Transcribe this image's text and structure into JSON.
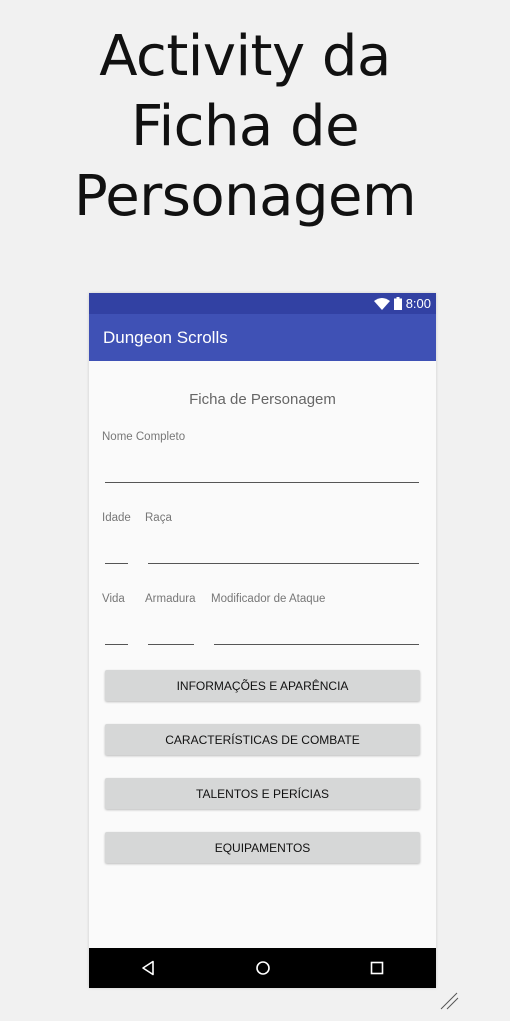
{
  "headline": {
    "line1": "Activity da",
    "line2": "Ficha de",
    "line3": "Personagem"
  },
  "status": {
    "time": "8:00"
  },
  "app": {
    "title": "Dungeon Scrolls"
  },
  "form": {
    "title": "Ficha de Personagem",
    "labels": {
      "nome": "Nome Completo",
      "idade": "Idade",
      "raca": "Raça",
      "vida": "Vida",
      "armadura": "Armadura",
      "modificador": "Modificador de Ataque"
    }
  },
  "buttons": [
    {
      "label": "INFORMAÇÕES E APARÊNCIA"
    },
    {
      "label": "CARACTERÍSTICAS DE COMBATE"
    },
    {
      "label": "TALENTOS E PERÍCIAS"
    },
    {
      "label": "EQUIPAMENTOS"
    }
  ],
  "icons": {
    "wifi": "wifi-icon",
    "battery": "battery-icon",
    "back": "back-icon",
    "home": "home-icon",
    "recents": "recents-icon"
  }
}
